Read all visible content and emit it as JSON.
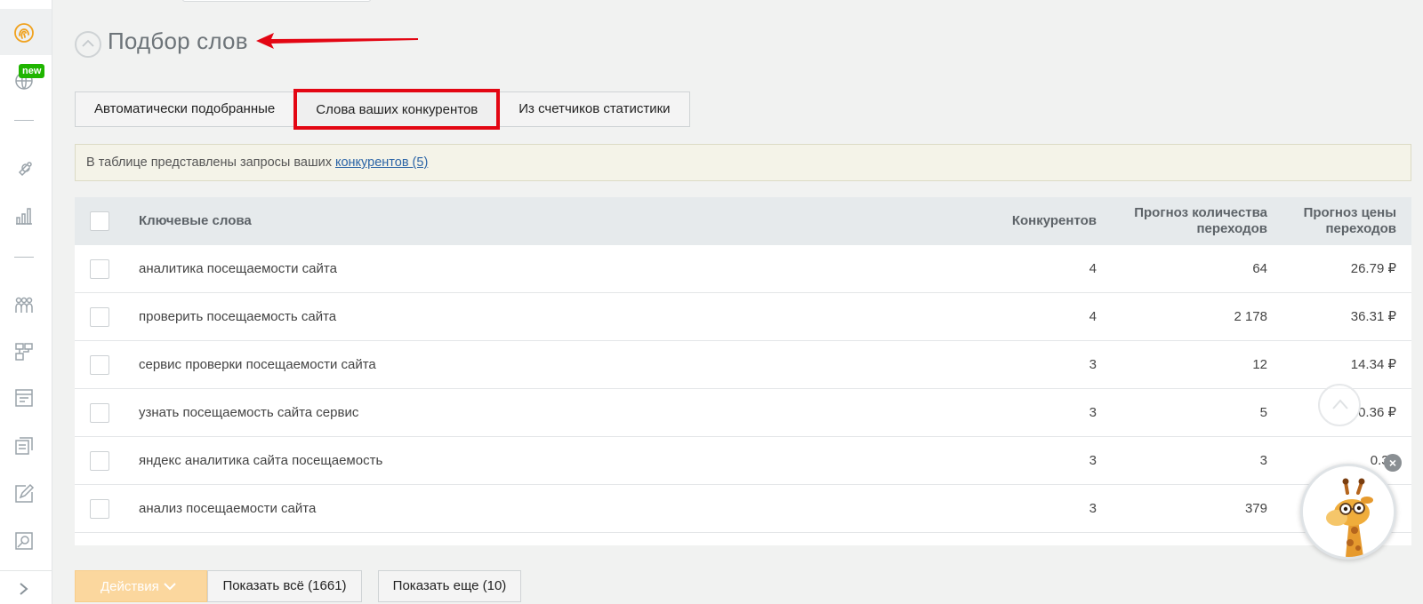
{
  "sidebar": {
    "icons": [
      "fingerprint-icon",
      "globe-icon",
      "separator",
      "wrench-icon",
      "analytics-icon",
      "separator",
      "team-icon",
      "structure-icon",
      "layout-icon",
      "documents-icon",
      "edit-icon",
      "search-doc-icon"
    ],
    "new_badge": "new"
  },
  "page": {
    "title": "Подбор слов"
  },
  "tabs": [
    {
      "label": "Автоматически подобранные",
      "active": false
    },
    {
      "label": "Слова ваших конкурентов",
      "active": true
    },
    {
      "label": "Из счетчиков статистики",
      "active": false
    }
  ],
  "info": {
    "text": "В таблице представлены запросы ваших ",
    "link": "конкурентов (5)"
  },
  "table": {
    "headers": {
      "keywords": "Ключевые слова",
      "competitors": "Конкурентов",
      "forecast_clicks": "Прогноз количества переходов",
      "forecast_clicks_line1": "Прогноз количества",
      "forecast_clicks_line2": "переходов",
      "forecast_price_line1": "Прогноз цены",
      "forecast_price_line2": "переходов"
    },
    "rows": [
      {
        "keyword": "аналитика посещаемости сайта",
        "competitors": "4",
        "clicks": "64",
        "price": "26.79 ₽"
      },
      {
        "keyword": "проверить посещаемость сайта",
        "competitors": "4",
        "clicks": "2 178",
        "price": "36.31 ₽"
      },
      {
        "keyword": "сервис проверки посещаемости сайта",
        "competitors": "3",
        "clicks": "12",
        "price": "14.34 ₽"
      },
      {
        "keyword": "узнать посещаемость сайта сервис",
        "competitors": "3",
        "clicks": "5",
        "price": "0.36 ₽"
      },
      {
        "keyword": "яндекс аналитика сайта посещаемость",
        "competitors": "3",
        "clicks": "3",
        "price": "0.36"
      },
      {
        "keyword": "анализ посещаемости сайта",
        "competitors": "3",
        "clicks": "379",
        "price": ""
      }
    ]
  },
  "footer": {
    "actions_label": "Действия",
    "show_all_label": "Показать всё (1661)",
    "show_more_label": "Показать еще (10)"
  },
  "colors": {
    "accent_red": "#e30613",
    "sidebar_active_icon": "#f0a21f",
    "new_badge": "#1fb500",
    "link": "#2b64a6",
    "actions_button": "#fbd79e"
  }
}
